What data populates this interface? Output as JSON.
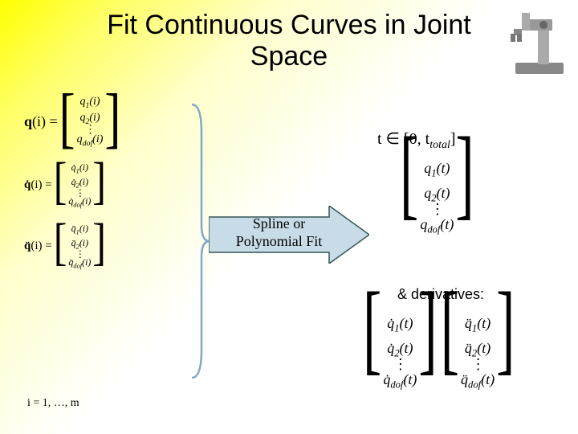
{
  "title": "Fit Continuous Curves in Joint\nSpace",
  "robot_alt": "robot-arm",
  "left": {
    "q": {
      "lhs_html": "<span class='bold'>q</span>(i) =",
      "rows": [
        "q<sub>1</sub>(i)",
        "q<sub>2</sub>(i)",
        "⋮",
        "q<sub>dof</sub>(i)"
      ]
    },
    "qd": {
      "lhs_html": "<span class='bold'>q̇</span>(i) =",
      "rows": [
        "q̇<sub>1</sub>(i)",
        "q̇<sub>2</sub>(i)",
        "⋮",
        "q̇<sub>dof</sub>(i)"
      ]
    },
    "qdd": {
      "lhs_html": "<span class='bold'>q̈</span>(i) =",
      "rows": [
        "q̈<sub>1</sub>(i)",
        "q̈<sub>2</sub>(i)",
        "⋮",
        "q̈<sub>dof</sub>(i)"
      ]
    }
  },
  "index_caption": "i = 1, …, m",
  "arrow_label": "Spline or\nPolynomial Fit",
  "t_domain": "t ∈ [0, t<sub>total</sub>]",
  "right_vec": {
    "rows": [
      "q<sub>1</sub>(t)",
      "q<sub>2</sub>(t)",
      "⋮",
      "q<sub>dof</sub>(t)"
    ]
  },
  "deriv_label": "& derivatives:",
  "deriv_qd": {
    "rows": [
      "q̇<sub>1</sub>(t)",
      "q̇<sub>2</sub>(t)",
      "⋮",
      "q̇<sub>dof</sub>(t)"
    ]
  },
  "deriv_qdd": {
    "rows": [
      "q̈<sub>1</sub>(t)",
      "q̈<sub>2</sub>(t)",
      "⋮",
      "q̈<sub>dof</sub>(t)"
    ]
  }
}
